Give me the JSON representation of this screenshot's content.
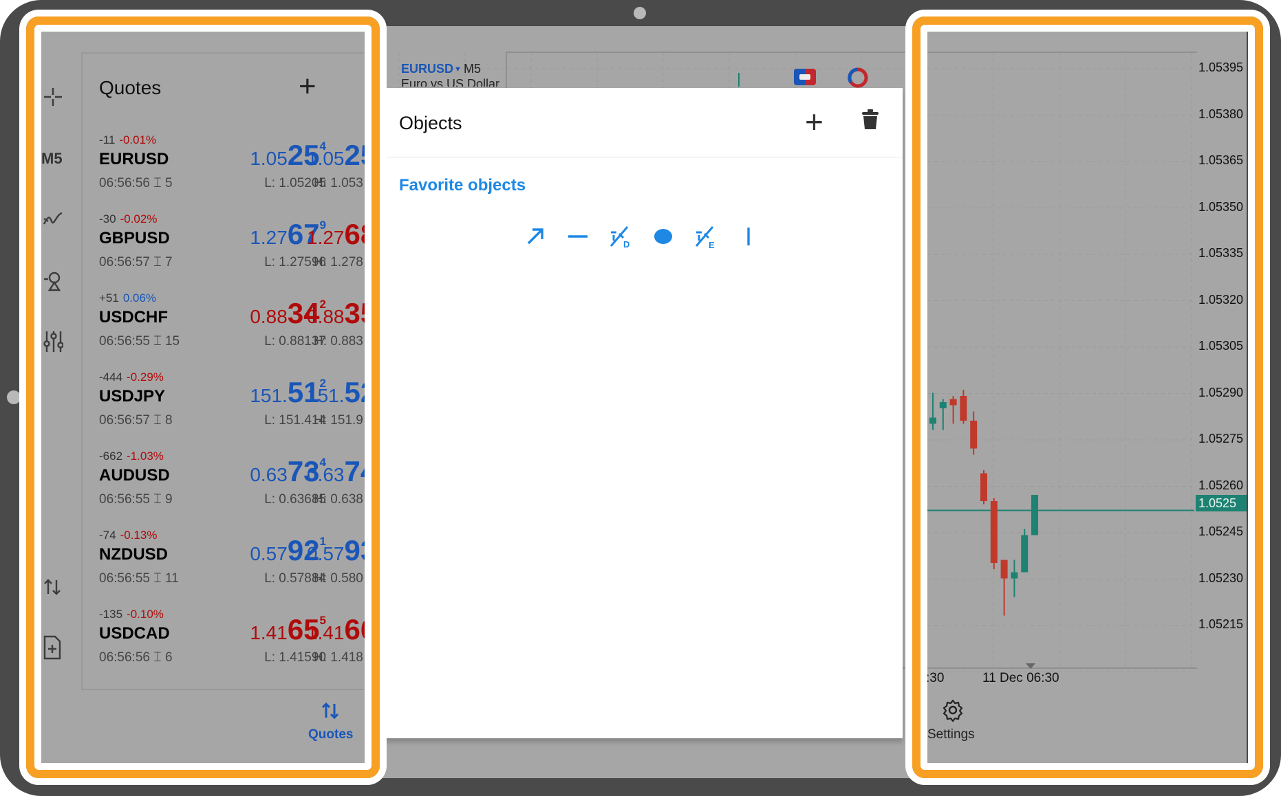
{
  "toolbar": {
    "timeframe": "M5"
  },
  "quotes": {
    "title": "Quotes",
    "rows": [
      {
        "change": "-11",
        "pct": "-0.01%",
        "pct_color": "red",
        "symbol": "EURUSD",
        "time": "06:56:56",
        "spread": "5",
        "bid_small": "1.05",
        "bid_big": "25",
        "bid_sup": "4",
        "bid_color": "blue",
        "ask_small": "1.05",
        "ask_big": "25",
        "ask_color": "blue",
        "low": "L: 1.05205",
        "high": "H: 1.053"
      },
      {
        "change": "-30",
        "pct": "-0.02%",
        "pct_color": "red",
        "symbol": "GBPUSD",
        "time": "06:56:57",
        "spread": "7",
        "bid_small": "1.27",
        "bid_big": "67",
        "bid_sup": "9",
        "bid_color": "blue",
        "ask_small": "1.27",
        "ask_big": "68",
        "ask_color": "red",
        "low": "L: 1.27596",
        "high": "H: 1.278"
      },
      {
        "change": "+51",
        "pct": "0.06%",
        "pct_color": "blue",
        "symbol": "USDCHF",
        "time": "06:56:55",
        "spread": "15",
        "bid_small": "0.88",
        "bid_big": "34",
        "bid_sup": "2",
        "bid_color": "red",
        "ask_small": "0.88",
        "ask_big": "35",
        "ask_color": "red",
        "low": "L: 0.88137",
        "high": "H: 0.883"
      },
      {
        "change": "-444",
        "pct": "-0.29%",
        "pct_color": "red",
        "symbol": "USDJPY",
        "time": "06:56:57",
        "spread": "8",
        "bid_small": "151.",
        "bid_big": "51",
        "bid_sup": "2",
        "bid_color": "blue",
        "ask_small": "151.",
        "ask_big": "52",
        "ask_color": "blue",
        "low": "L: 151.414",
        "high": "H: 151.9"
      },
      {
        "change": "-662",
        "pct": "-1.03%",
        "pct_color": "red",
        "symbol": "AUDUSD",
        "time": "06:56:55",
        "spread": "9",
        "bid_small": "0.63",
        "bid_big": "73",
        "bid_sup": "4",
        "bid_color": "blue",
        "ask_small": "0.63",
        "ask_big": "74",
        "ask_color": "blue",
        "low": "L: 0.63685",
        "high": "H: 0.638"
      },
      {
        "change": "-74",
        "pct": "-0.13%",
        "pct_color": "red",
        "symbol": "NZDUSD",
        "time": "06:56:55",
        "spread": "11",
        "bid_small": "0.57",
        "bid_big": "92",
        "bid_sup": "1",
        "bid_color": "blue",
        "ask_small": "0.57",
        "ask_big": "93",
        "ask_color": "blue",
        "low": "L: 0.57884",
        "high": "H: 0.580"
      },
      {
        "change": "-135",
        "pct": "-0.10%",
        "pct_color": "red",
        "symbol": "USDCAD",
        "time": "06:56:56",
        "spread": "6",
        "bid_small": "1.41",
        "bid_big": "65",
        "bid_sup": "5",
        "bid_color": "red",
        "ask_small": "1.41",
        "ask_big": "66",
        "ask_color": "red",
        "low": "L: 1.41590",
        "high": "H: 1.418"
      }
    ],
    "tab_label": "Quotes"
  },
  "chart": {
    "symbol": "EURUSD",
    "timeframe": "M5",
    "subtitle": "Euro vs US Dollar",
    "price_levels": [
      "1.05395",
      "1.05380",
      "1.05365",
      "1.05350",
      "1.05335",
      "1.05320",
      "1.05305",
      "1.05290",
      "1.05275",
      "1.05260",
      "1.05245",
      "1.05230",
      "1.05215"
    ],
    "current_price": "1.0525",
    "time_labels": [
      ":30",
      "11 Dec 06:30"
    ],
    "settings_label": "Settings"
  },
  "objects_panel": {
    "title": "Objects",
    "favorites_label": "Favorite objects",
    "favorite_icons": [
      "arrow-line-icon",
      "horizontal-line-icon",
      "fibonacci-fan-icon",
      "ellipse-icon",
      "fibonacci-expansion-icon",
      "vertical-line-icon"
    ],
    "accent": "#1e88e5"
  },
  "highlight_color": "#f7a023",
  "candles": [
    {
      "o": 1.0528,
      "h": 1.0529,
      "l": 1.05278,
      "c": 1.05282,
      "bull": true
    },
    {
      "o": 1.05285,
      "h": 1.05288,
      "l": 1.05278,
      "c": 1.05287,
      "bull": true
    },
    {
      "o": 1.05288,
      "h": 1.05289,
      "l": 1.0528,
      "c": 1.05286,
      "bull": false
    },
    {
      "o": 1.05289,
      "h": 1.05291,
      "l": 1.0528,
      "c": 1.05281,
      "bull": false
    },
    {
      "o": 1.05281,
      "h": 1.05284,
      "l": 1.0527,
      "c": 1.05272,
      "bull": false
    },
    {
      "o": 1.05264,
      "h": 1.05265,
      "l": 1.05254,
      "c": 1.05255,
      "bull": false
    },
    {
      "o": 1.05255,
      "h": 1.05256,
      "l": 1.05233,
      "c": 1.05235,
      "bull": false
    },
    {
      "o": 1.05236,
      "h": 1.05236,
      "l": 1.05218,
      "c": 1.0523,
      "bull": false
    },
    {
      "o": 1.0523,
      "h": 1.05236,
      "l": 1.05224,
      "c": 1.05232,
      "bull": true
    },
    {
      "o": 1.05232,
      "h": 1.05246,
      "l": 1.05232,
      "c": 1.05244,
      "bull": true
    },
    {
      "o": 1.05244,
      "h": 1.05255,
      "l": 1.05244,
      "c": 1.05257,
      "bull": true
    }
  ]
}
